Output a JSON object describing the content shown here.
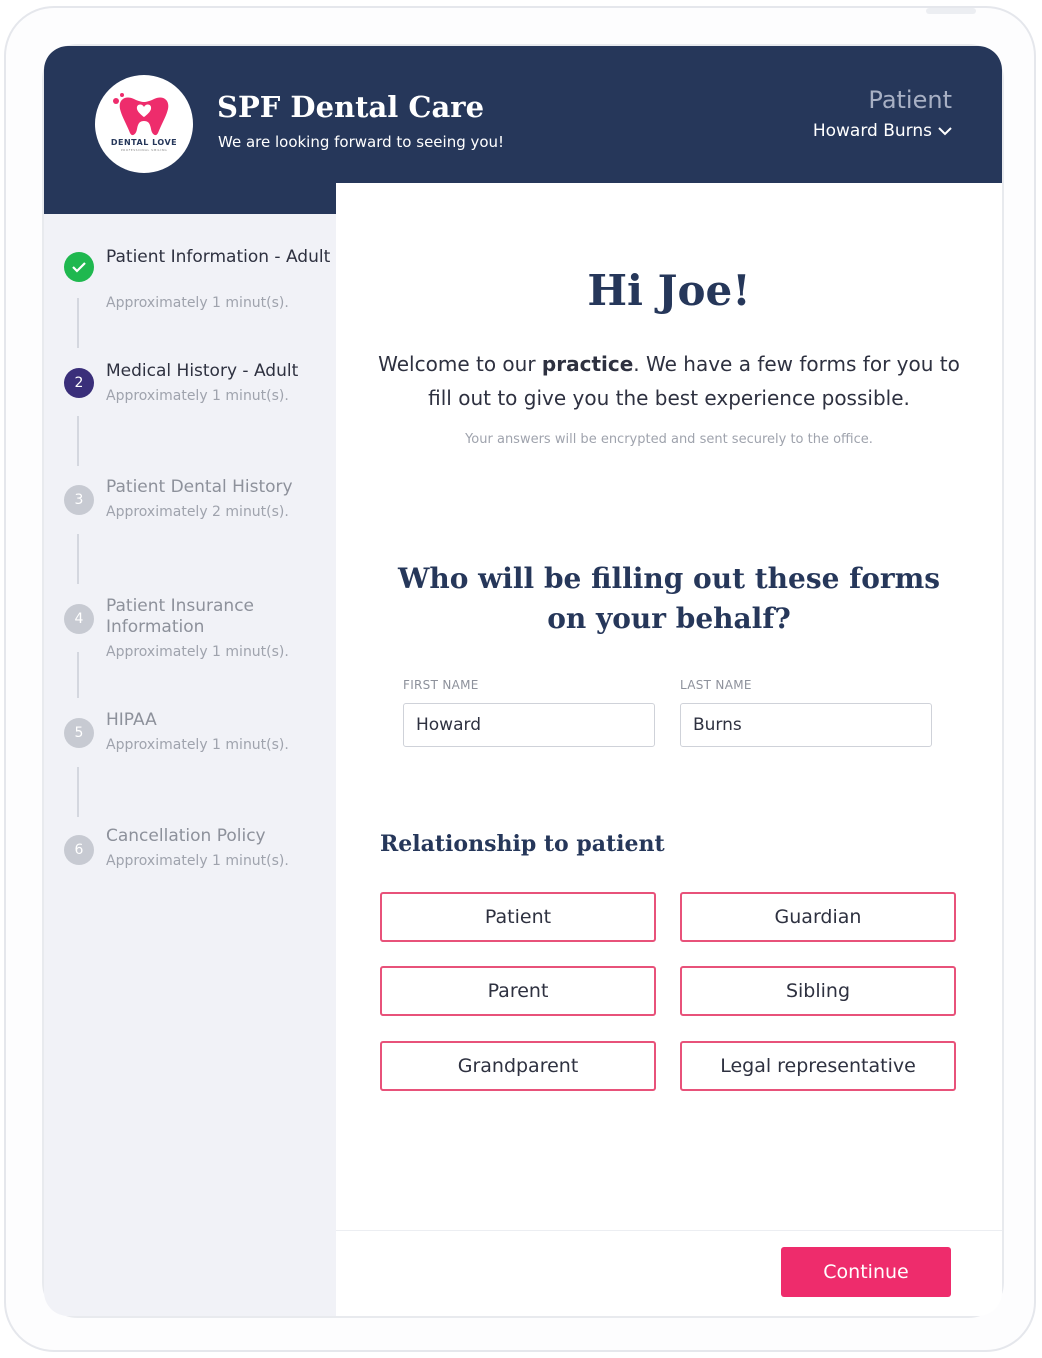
{
  "header": {
    "logo_text": "DENTAL LOVE",
    "logo_subtext": "PROFESSIONAL SMILING",
    "brand_title": "SPF Dental Care",
    "tagline": "We are looking forward to seeing you!",
    "role_label": "Patient",
    "patient_name": "Howard Burns"
  },
  "sidebar": {
    "steps": [
      {
        "number": "1",
        "title": "Patient Information - Adult",
        "time": "Approximately 1 minut(s).",
        "state": "completed"
      },
      {
        "number": "2",
        "title": "Medical History - Adult",
        "time": "Approximately 1 minut(s).",
        "state": "active"
      },
      {
        "number": "3",
        "title": "Patient Dental History",
        "time": "Approximately 2 minut(s).",
        "state": "pending"
      },
      {
        "number": "4",
        "title": "Patient Insurance Information",
        "time": "Approximately 1 minut(s).",
        "state": "pending"
      },
      {
        "number": "5",
        "title": "HIPAA",
        "time": "Approximately 1 minut(s).",
        "state": "pending"
      },
      {
        "number": "6",
        "title": "Cancellation Policy",
        "time": "Approximately 1 minut(s).",
        "state": "pending"
      }
    ]
  },
  "main": {
    "greeting": "Hi Joe!",
    "welcome_before": "Welcome to our ",
    "welcome_bold": "practice",
    "welcome_after": ". We have a few forms for you to fill out to give you the best experience possible.",
    "secure_note": "Your answers will be encrypted and sent securely to the office.",
    "who_title": "Who will be filling out these forms on your behalf?",
    "first_name_label": "FIRST NAME",
    "first_name_value": "Howard",
    "last_name_label": "LAST NAME",
    "last_name_value": "Burns",
    "relationship_title": "Relationship to patient",
    "relationships": [
      "Patient",
      "Guardian",
      "Parent",
      "Sibling",
      "Grandparent",
      "Legal representative"
    ],
    "continue_label": "Continue"
  },
  "colors": {
    "navy": "#26375a",
    "accent_pink": "#ee2c6c",
    "completed_green": "#1fb84f",
    "active_purple": "#3a2f7a",
    "pending_grey": "#c7cad2"
  }
}
